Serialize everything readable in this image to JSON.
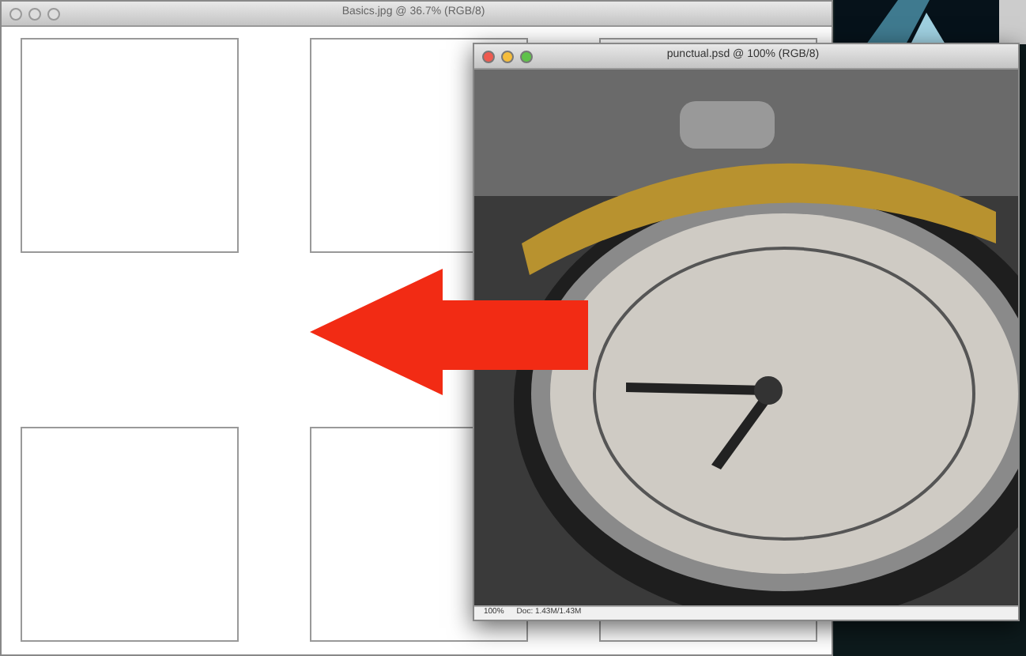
{
  "back_window": {
    "title": "Basics.jpg @ 36.7% (RGB/8)",
    "active": false
  },
  "front_window": {
    "title": "punctual.psd @ 100% (RGB/8)",
    "active": true,
    "status_bar": {
      "zoom": "100%",
      "doc": "Doc: 1.43M/1.43M"
    }
  }
}
